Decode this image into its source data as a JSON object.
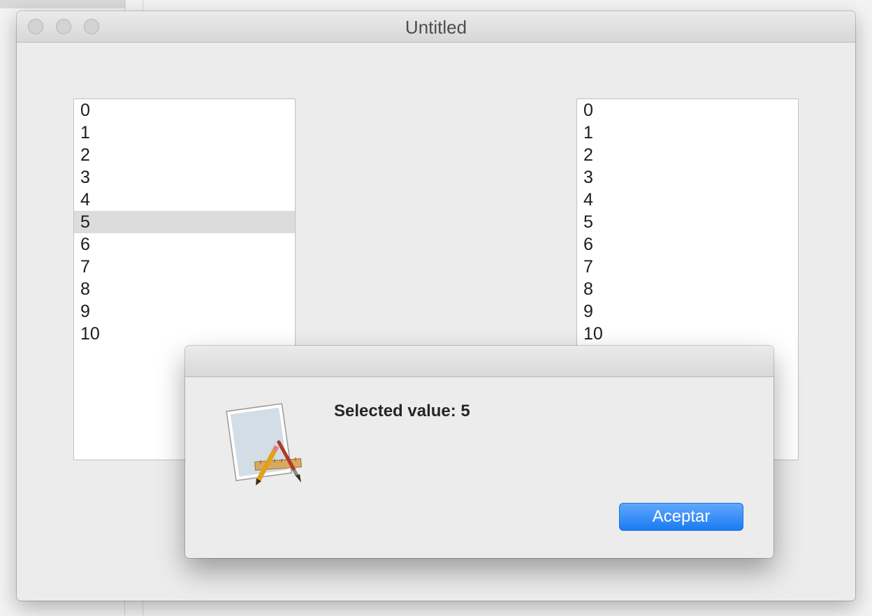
{
  "window": {
    "title": "Untitled"
  },
  "left_list": {
    "items": [
      "0",
      "1",
      "2",
      "3",
      "4",
      "5",
      "6",
      "7",
      "8",
      "9",
      "10"
    ],
    "selected": "5"
  },
  "right_list": {
    "items": [
      "0",
      "1",
      "2",
      "3",
      "4",
      "5",
      "6",
      "7",
      "8",
      "9",
      "10"
    ]
  },
  "alert": {
    "icon": "app-icon",
    "message": "Selected value: 5",
    "button_label": "Aceptar"
  },
  "colors": {
    "accent": "#1a7bf2",
    "selection": "#dcdcdc"
  }
}
